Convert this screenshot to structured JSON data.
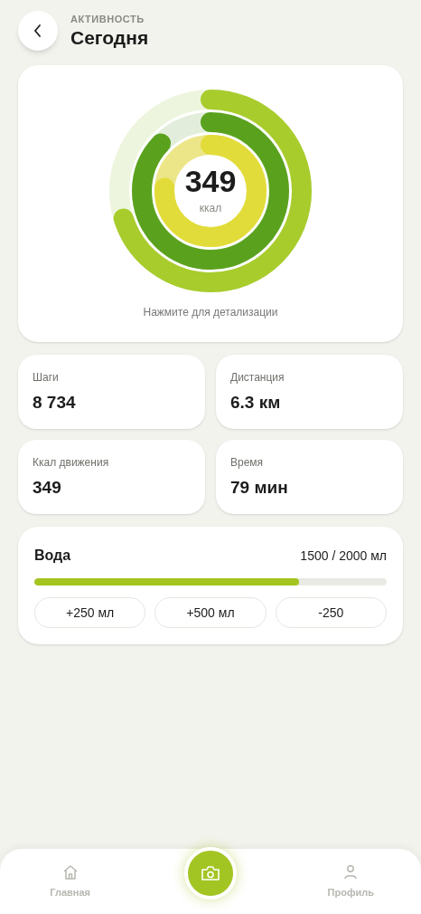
{
  "header": {
    "overline": "АКТИВНОСТЬ",
    "title": "Сегодня"
  },
  "rings": [
    {
      "color": "#a8cc2c"
    },
    {
      "color": "#5aa21e"
    },
    {
      "color": "#e2dc3a"
    }
  ],
  "ring_value": "349",
  "ring_unit": "ккал",
  "ring_hint": "Нажмите для детализации",
  "stats": [
    {
      "label": "Шаги",
      "value": "8 734"
    },
    {
      "label": "Дистанция",
      "value": "6.3 км"
    },
    {
      "label": "Ккал движения",
      "value": "349"
    },
    {
      "label": "Время",
      "value": "79 мин"
    }
  ],
  "water": {
    "title": "Вода",
    "reading": "1500 / 2000 мл",
    "level": 0.75,
    "buttons": [
      "+250 мл",
      "+500 мл",
      "-250"
    ]
  },
  "nav": [
    {
      "kind": "home",
      "label": "Главная"
    },
    {
      "kind": "camera"
    },
    {
      "kind": "profile",
      "label": "Профиль"
    }
  ]
}
